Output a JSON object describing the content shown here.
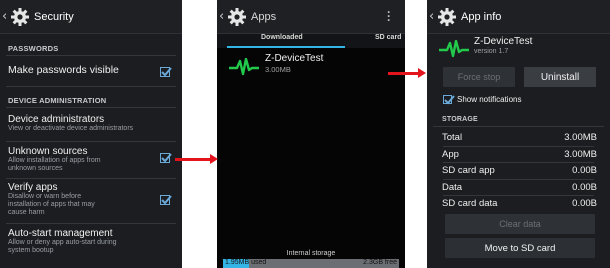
{
  "security": {
    "title": "Security",
    "section_passwords": "PASSWORDS",
    "make_passwords_visible": "Make passwords visible",
    "section_device_admin": "DEVICE ADMINISTRATION",
    "device_admins": {
      "title": "Device administrators",
      "summary": "View or deactivate device administrators"
    },
    "unknown_sources": {
      "title": "Unknown sources",
      "summary_1": "Allow installation of apps from",
      "summary_2": "unknown sources"
    },
    "verify_apps": {
      "title": "Verify apps",
      "summary_1": "Disallow or warn before",
      "summary_2": "installation of apps that may",
      "summary_3": "cause harm"
    },
    "auto_start": {
      "title": "Auto-start management",
      "summary_1": "Allow or deny app auto-start during",
      "summary_2": "system bootup"
    }
  },
  "apps": {
    "title": "Apps",
    "tab_downloaded": "Downloaded",
    "tab_sd_card": "SD card",
    "item": {
      "name": "Z-DeviceTest",
      "size": "3.00MB"
    },
    "storage_label": "Internal storage",
    "used_value": "1.9",
    "used_label": "5MB used",
    "free_label": "2.3GB free",
    "used_fraction": 0.15
  },
  "app_info": {
    "title": "App info",
    "name": "Z-DeviceTest",
    "version": "version 1.7",
    "force_stop": "Force stop",
    "uninstall": "Uninstall",
    "show_notifications": "Show notifications",
    "section_storage": "STORAGE",
    "storage_rows": [
      {
        "label": "Total",
        "value": "3.00MB"
      },
      {
        "label": "App",
        "value": "3.00MB"
      },
      {
        "label": "SD card app",
        "value": "0.00B"
      },
      {
        "label": "Data",
        "value": "0.00B"
      },
      {
        "label": "SD card data",
        "value": "0.00B"
      }
    ],
    "clear_data": "Clear data",
    "move_to_sd": "Move to SD card"
  },
  "colors": {
    "accent": "#33b5e5",
    "checkbox": "#6aa9d8",
    "arrow": "#e3141b",
    "app_icon": "#22c94a"
  }
}
